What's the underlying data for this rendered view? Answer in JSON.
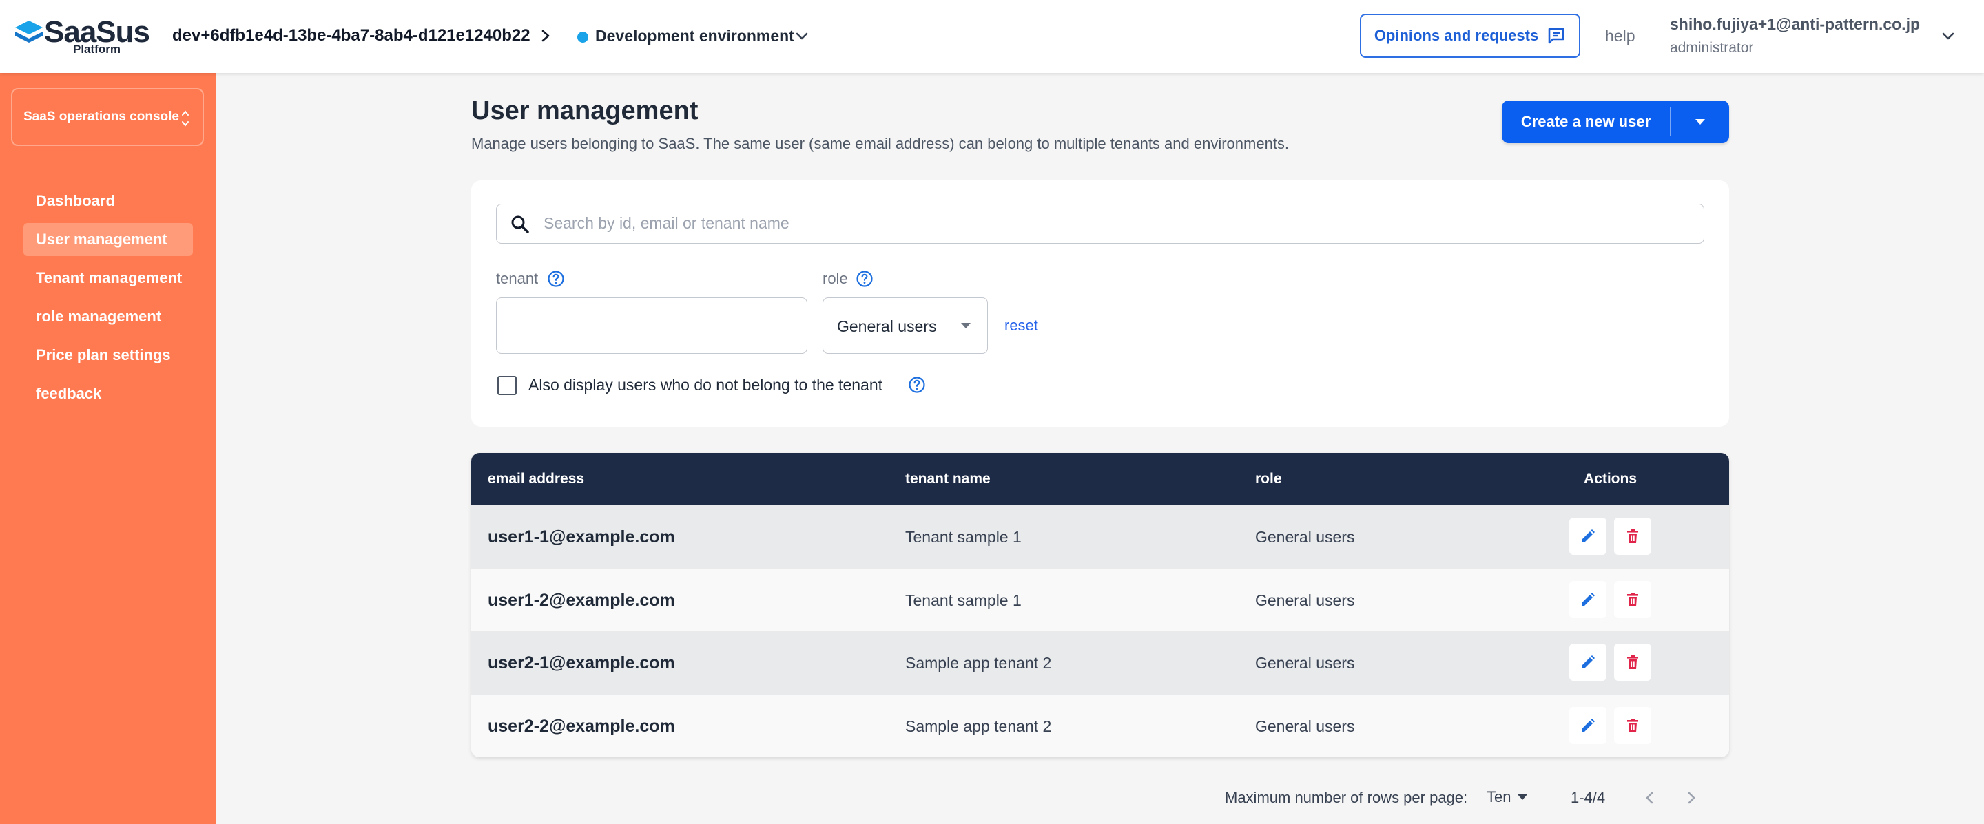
{
  "header": {
    "logo_text": "SaaSus",
    "logo_sub": "Platform",
    "env_id": "dev+6dfb1e4d-13be-4ba7-8ab4-d121e1240b22",
    "env_name": "Development environment",
    "env_status_color": "#1aa3e8",
    "opinions_label": "Opinions and requests",
    "help_label": "help",
    "user_email": "shiho.fujiya+1@anti-pattern.co.jp",
    "user_role": "administrator"
  },
  "sidebar": {
    "console_label": "SaaS operations console",
    "items": [
      {
        "label": "Dashboard"
      },
      {
        "label": "User management"
      },
      {
        "label": "Tenant management"
      },
      {
        "label": "role management"
      },
      {
        "label": "Price plan settings"
      },
      {
        "label": "feedback"
      }
    ],
    "active_index": 1
  },
  "main": {
    "title": "User management",
    "description": "Manage users belonging to SaaS. The same user (same email address) can belong to multiple tenants and environments.",
    "create_label": "Create a new user",
    "search": {
      "placeholder": "Search by id, email or tenant name",
      "value": ""
    },
    "filters": {
      "tenant_label": "tenant",
      "tenant_value": "",
      "role_label": "role",
      "role_value": "General users",
      "reset_label": "reset",
      "checkbox_label": "Also display users who do not belong to the tenant",
      "checkbox_checked": false
    }
  },
  "table": {
    "columns": [
      "email address",
      "tenant name",
      "role",
      "Actions"
    ],
    "rows": [
      {
        "email": "user1-1@example.com",
        "tenant": "Tenant sample 1",
        "role": "General users"
      },
      {
        "email": "user1-2@example.com",
        "tenant": "Tenant sample 1",
        "role": "General users"
      },
      {
        "email": "user2-1@example.com",
        "tenant": "Sample app tenant 2",
        "role": "General users"
      },
      {
        "email": "user2-2@example.com",
        "tenant": "Sample app tenant 2",
        "role": "General users"
      }
    ]
  },
  "pagination": {
    "rows_label": "Maximum number of rows per page:",
    "rows_value": "Ten",
    "range": "1-4/4"
  },
  "colors": {
    "brand_orange": "#ff7a50",
    "primary_blue": "#0b5ff0",
    "table_header": "#1e2b47",
    "delete_red": "#e0244a"
  },
  "icons": {
    "logo": "saasus-logo-icon",
    "env_chevron": "chevron-right-icon",
    "opinions": "chat-bubble-icon",
    "search": "search-icon",
    "help": "question-circle-icon",
    "edit": "pencil-icon",
    "delete": "trash-icon"
  }
}
